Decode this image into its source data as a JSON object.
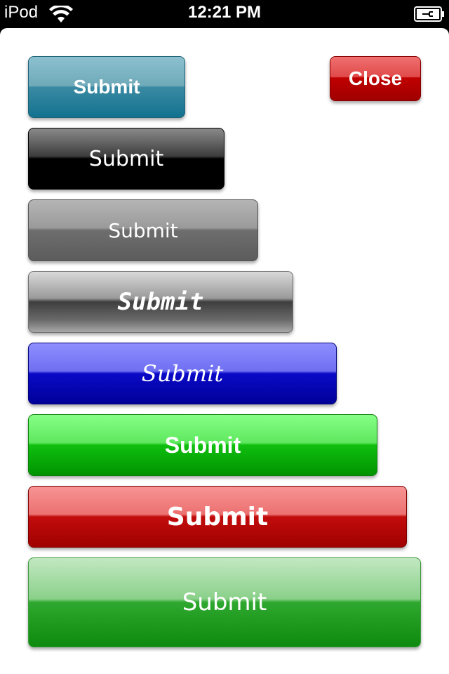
{
  "status_bar": {
    "carrier": "iPod",
    "time": "12:21 PM",
    "wifi_icon": "wifi-icon",
    "battery_icon": "battery-charging-icon"
  },
  "modal": {
    "close_label": "Close",
    "buttons": [
      {
        "label": "Submit",
        "color": "#13728f"
      },
      {
        "label": "Submit",
        "color": "#000000"
      },
      {
        "label": "Submit",
        "color": "#5c5c5c"
      },
      {
        "label": "Submit",
        "color": "#3e3e3e"
      },
      {
        "label": "Submit",
        "color": "#000098"
      },
      {
        "label": "Submit",
        "color": "#009300"
      },
      {
        "label": "Submit",
        "color": "#a00000"
      },
      {
        "label": "Submit",
        "color": "#0e8a0e"
      }
    ]
  }
}
